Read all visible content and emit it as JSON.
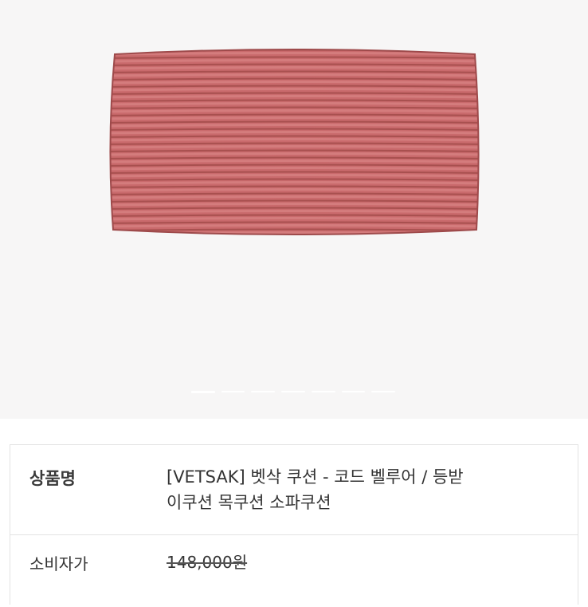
{
  "product": {
    "name_label": "상품명",
    "name_line1": "[VETSAK] 벳삭 쿠션 - 코드 벨루어 / 등받",
    "name_line2": "이쿠션 목쿠션 소파쿠션",
    "price_label": "소비자가",
    "price_value": "148,000원"
  },
  "gallery": {
    "slide_count": 7,
    "active_index": 0,
    "image_subject": "pink-corduroy-cushion"
  },
  "colors": {
    "pillow": "#c96a6c",
    "pillow_rib_dark": "#a8504f",
    "pillow_rib_light": "#d98585",
    "hero_bg": "#f7f6f6",
    "border": "#e3e3e3"
  }
}
